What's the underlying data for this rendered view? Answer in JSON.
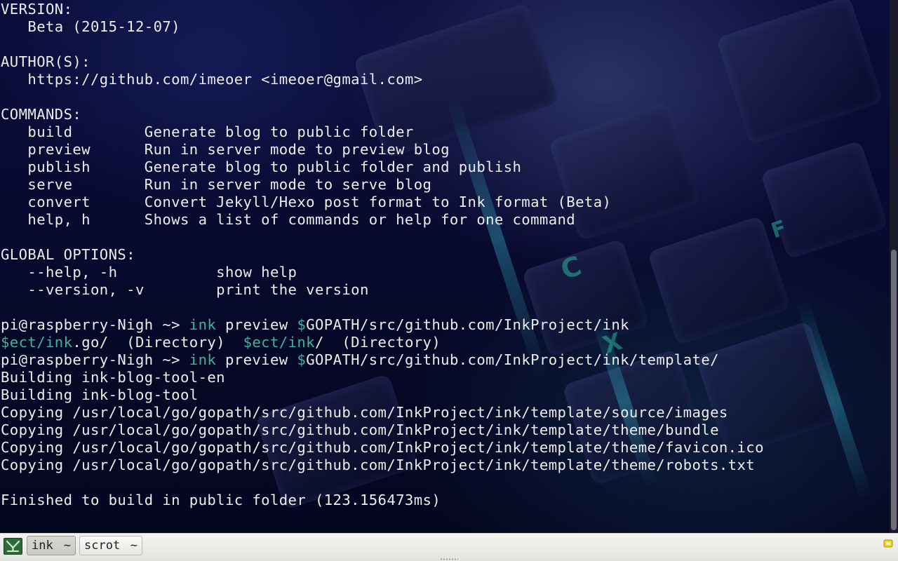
{
  "terminal": {
    "lines": [
      [
        {
          "text": "VERSION:"
        }
      ],
      [
        {
          "text": "   Beta (2015-12-07)"
        }
      ],
      [
        {
          "text": ""
        }
      ],
      [
        {
          "text": "AUTHOR(S):"
        }
      ],
      [
        {
          "text": "   https://github.com/imeoer <imeoer@gmail.com>"
        }
      ],
      [
        {
          "text": ""
        }
      ],
      [
        {
          "text": "COMMANDS:"
        }
      ],
      [
        {
          "text": "   build        Generate blog to public folder"
        }
      ],
      [
        {
          "text": "   preview      Run in server mode to preview blog"
        }
      ],
      [
        {
          "text": "   publish      Generate blog to public folder and publish"
        }
      ],
      [
        {
          "text": "   serve        Run in server mode to serve blog"
        }
      ],
      [
        {
          "text": "   convert      Convert Jekyll/Hexo post format to Ink format (Beta)"
        }
      ],
      [
        {
          "text": "   help, h      Shows a list of commands or help for one command"
        }
      ],
      [
        {
          "text": ""
        }
      ],
      [
        {
          "text": "GLOBAL OPTIONS:"
        }
      ],
      [
        {
          "text": "   --help, -h           show help"
        }
      ],
      [
        {
          "text": "   --version, -v        print the version"
        }
      ],
      [
        {
          "text": ""
        }
      ],
      [
        {
          "text": "pi@raspberry-Nigh ~> "
        },
        {
          "text": "ink",
          "color": "green"
        },
        {
          "text": " preview "
        },
        {
          "text": "$",
          "color": "green"
        },
        {
          "text": "GOPATH/src/github.com/InkProject/ink"
        }
      ],
      [
        {
          "text": "$ect/ink",
          "color": "green"
        },
        {
          "text": ".go/  (Directory)  "
        },
        {
          "text": "$ect/ink",
          "color": "green"
        },
        {
          "text": "/  (Directory)"
        }
      ],
      [
        {
          "text": "pi@raspberry-Nigh ~> "
        },
        {
          "text": "ink",
          "color": "green"
        },
        {
          "text": " preview "
        },
        {
          "text": "$",
          "color": "green"
        },
        {
          "text": "GOPATH/src/github.com/InkProject/ink/template/"
        }
      ],
      [
        {
          "text": "Building ink-blog-tool-en"
        }
      ],
      [
        {
          "text": "Building ink-blog-tool"
        }
      ],
      [
        {
          "text": "Copying /usr/local/go/gopath/src/github.com/InkProject/ink/template/source/images"
        }
      ],
      [
        {
          "text": "Copying /usr/local/go/gopath/src/github.com/InkProject/ink/template/theme/bundle"
        }
      ],
      [
        {
          "text": "Copying /usr/local/go/gopath/src/github.com/InkProject/ink/template/theme/favicon.ico"
        }
      ],
      [
        {
          "text": "Copying /usr/local/go/gopath/src/github.com/InkProject/ink/template/theme/robots.txt"
        }
      ],
      [
        {
          "text": ""
        }
      ],
      [
        {
          "text": "Finished to build in public folder (123.156473ms)"
        }
      ]
    ]
  },
  "taskbar": {
    "menu_icon": "download-arrow-icon",
    "tasks": [
      {
        "label": "ink",
        "suffix": "~",
        "active": true
      },
      {
        "label": "scrot",
        "suffix": "~",
        "active": false
      }
    ],
    "tray_icon": "notification-icon"
  },
  "colors": {
    "terminal_text": "#ececec",
    "terminal_accent": "#3cb29b",
    "taskbar_bg": "#e9e9e4"
  }
}
